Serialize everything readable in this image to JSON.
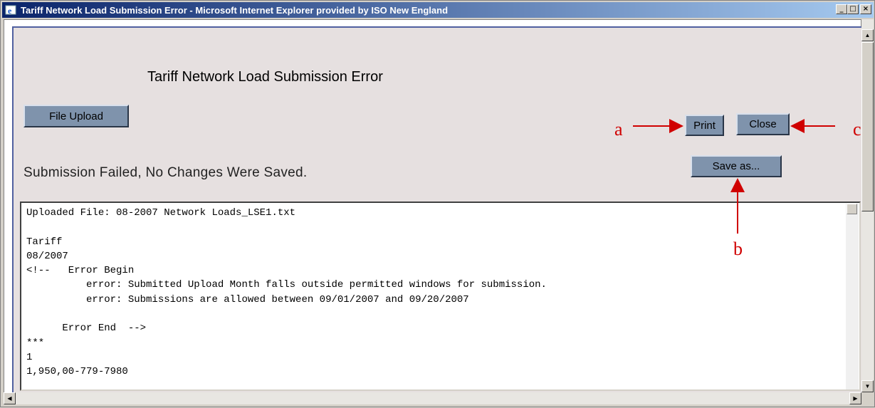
{
  "window": {
    "title": "Tariff Network Load Submission Error - Microsoft Internet Explorer provided by ISO New England",
    "icon": "ie-icon",
    "controls": {
      "minimize": "_",
      "maximize": "□",
      "close": "×"
    }
  },
  "page": {
    "heading": "Tariff Network Load Submission Error",
    "file_upload_label": "File Upload",
    "print_label": "Print",
    "close_label": "Close",
    "save_as_label": "Save as...",
    "status_message": "Submission Failed, No Changes Were Saved."
  },
  "log": {
    "lines": [
      "Uploaded File: 08-2007 Network Loads_LSE1.txt",
      "",
      "Tariff",
      "08/2007",
      "<!--   Error Begin",
      "          error: Submitted Upload Month falls outside permitted windows for submission.",
      "          error: Submissions are allowed between 09/01/2007 and 09/20/2007",
      "",
      "      Error End  -->",
      "***",
      "1",
      "1,950,00-779-7980"
    ]
  },
  "annotations": {
    "a": "a",
    "b": "b",
    "c": "c"
  },
  "colors": {
    "annotation": "#d00000",
    "button": "#7f93ac",
    "page_background": "#e6e0e0",
    "title_bar": "#0a246a"
  }
}
